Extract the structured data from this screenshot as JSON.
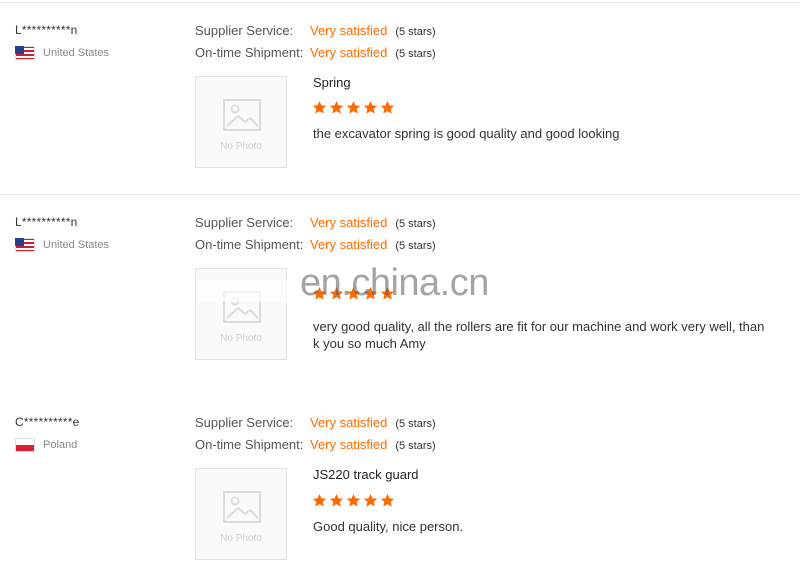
{
  "labels": {
    "supplier_service": "Supplier Service:",
    "ontime_shipment": "On-time Shipment:",
    "no_photo": "No Photo"
  },
  "colors": {
    "accent": "#ff6a00"
  },
  "reviews": [
    {
      "buyer": "L**********n",
      "country": "United States",
      "flag_icon": "us-flag-icon",
      "supplier_service": {
        "value": "Very satisfied",
        "stars": "(5 stars)"
      },
      "ontime_shipment": {
        "value": "Very satisfied",
        "stars": "(5 stars)"
      },
      "product": "Spring",
      "rating": 5,
      "comment": "the excavator spring is good quality and good looking"
    },
    {
      "buyer": "L**********n",
      "country": "United States",
      "flag_icon": "us-flag-icon",
      "supplier_service": {
        "value": "Very satisfied",
        "stars": "(5 stars)"
      },
      "ontime_shipment": {
        "value": "Very satisfied",
        "stars": "(5 stars)"
      },
      "product": "",
      "rating": 5,
      "comment": "very good quality, all the rollers are fit for our machine and work very well, than k you so much Amy"
    },
    {
      "buyer": "C**********e",
      "country": "Poland",
      "flag_icon": "poland-flag-icon",
      "supplier_service": {
        "value": "Very satisfied",
        "stars": "(5 stars)"
      },
      "ontime_shipment": {
        "value": "Very satisfied",
        "stars": "(5 stars)"
      },
      "product": "JS220 track guard",
      "rating": 5,
      "comment": "Good quality, nice person."
    }
  ],
  "watermark": "en.china.cn"
}
